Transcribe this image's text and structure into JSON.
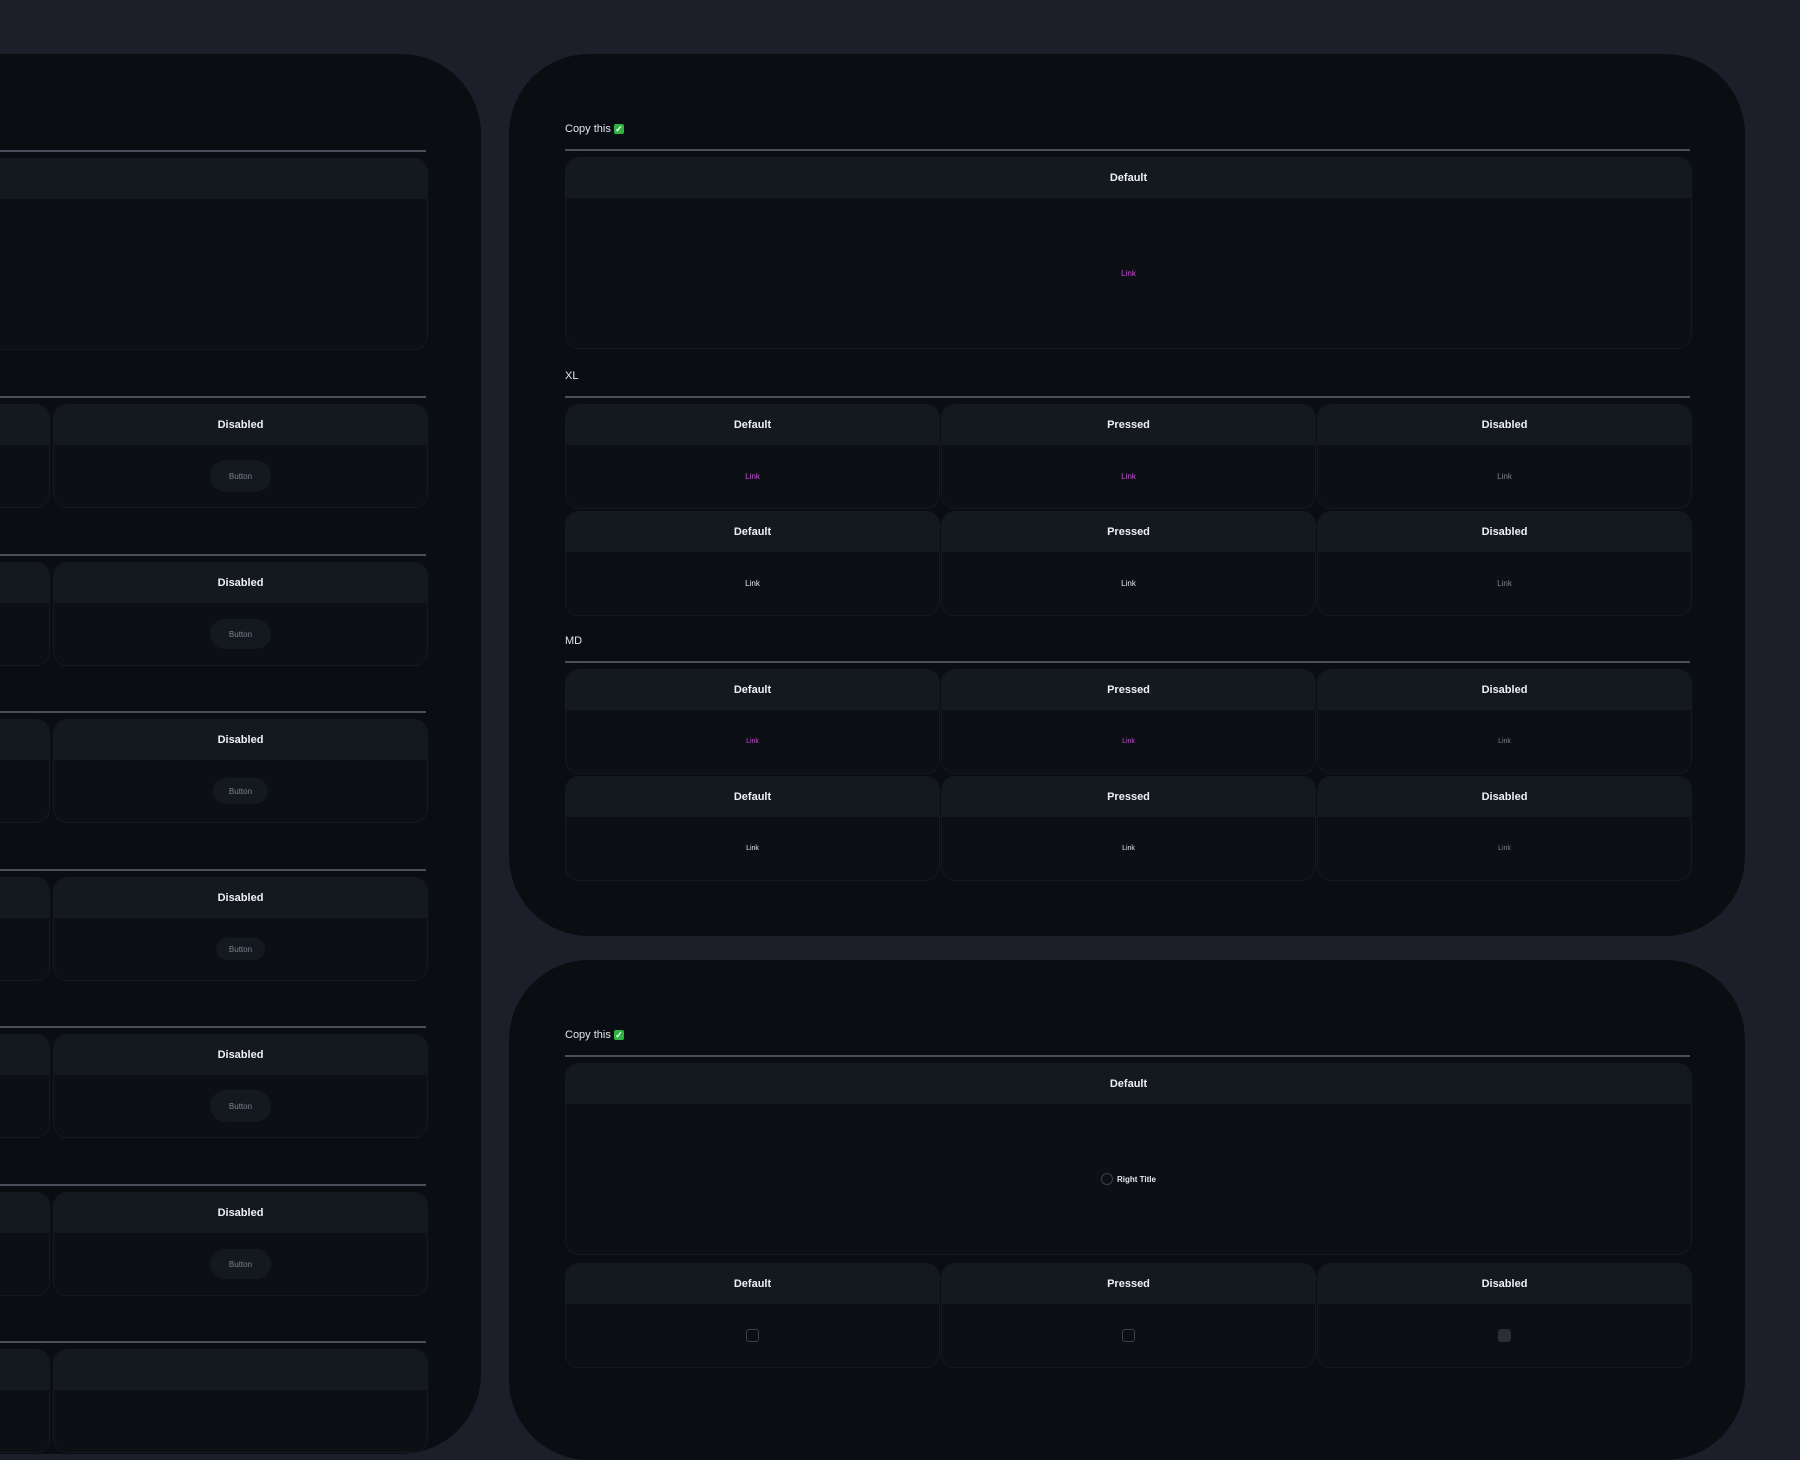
{
  "colors": {
    "page_background": "#1c1f29",
    "frame": "#0a0d12",
    "card_header": "#141920",
    "accent_link": "#c64fd6",
    "check_emoji": "#2fb344"
  },
  "left_frame": {
    "disabled_label": "Disabled",
    "button_label": "Button"
  },
  "link_frame": {
    "copy_label": "Copy this",
    "check_icon": "check-emoji-icon",
    "default_card": {
      "header": "Default",
      "link": "Link"
    },
    "xl": {
      "label": "XL",
      "rows": [
        {
          "cards": [
            {
              "header": "Default",
              "link": "Link"
            },
            {
              "header": "Pressed",
              "link": "Link"
            },
            {
              "header": "Disabled",
              "link": "Link"
            }
          ]
        },
        {
          "cards": [
            {
              "header": "Default",
              "link": "Link"
            },
            {
              "header": "Pressed",
              "link": "Link"
            },
            {
              "header": "Disabled",
              "link": "Link"
            }
          ]
        }
      ]
    },
    "md": {
      "label": "MD",
      "rows": [
        {
          "cards": [
            {
              "header": "Default",
              "link": "Link"
            },
            {
              "header": "Pressed",
              "link": "Link"
            },
            {
              "header": "Disabled",
              "link": "Link"
            }
          ]
        },
        {
          "cards": [
            {
              "header": "Default",
              "link": "Link"
            },
            {
              "header": "Pressed",
              "link": "Link"
            },
            {
              "header": "Disabled",
              "link": "Link"
            }
          ]
        }
      ]
    }
  },
  "radio_frame": {
    "copy_label": "Copy this",
    "default_card": {
      "header": "Default",
      "radio_label": "Right Title"
    },
    "row": [
      {
        "header": "Default"
      },
      {
        "header": "Pressed"
      },
      {
        "header": "Disabled"
      }
    ]
  }
}
